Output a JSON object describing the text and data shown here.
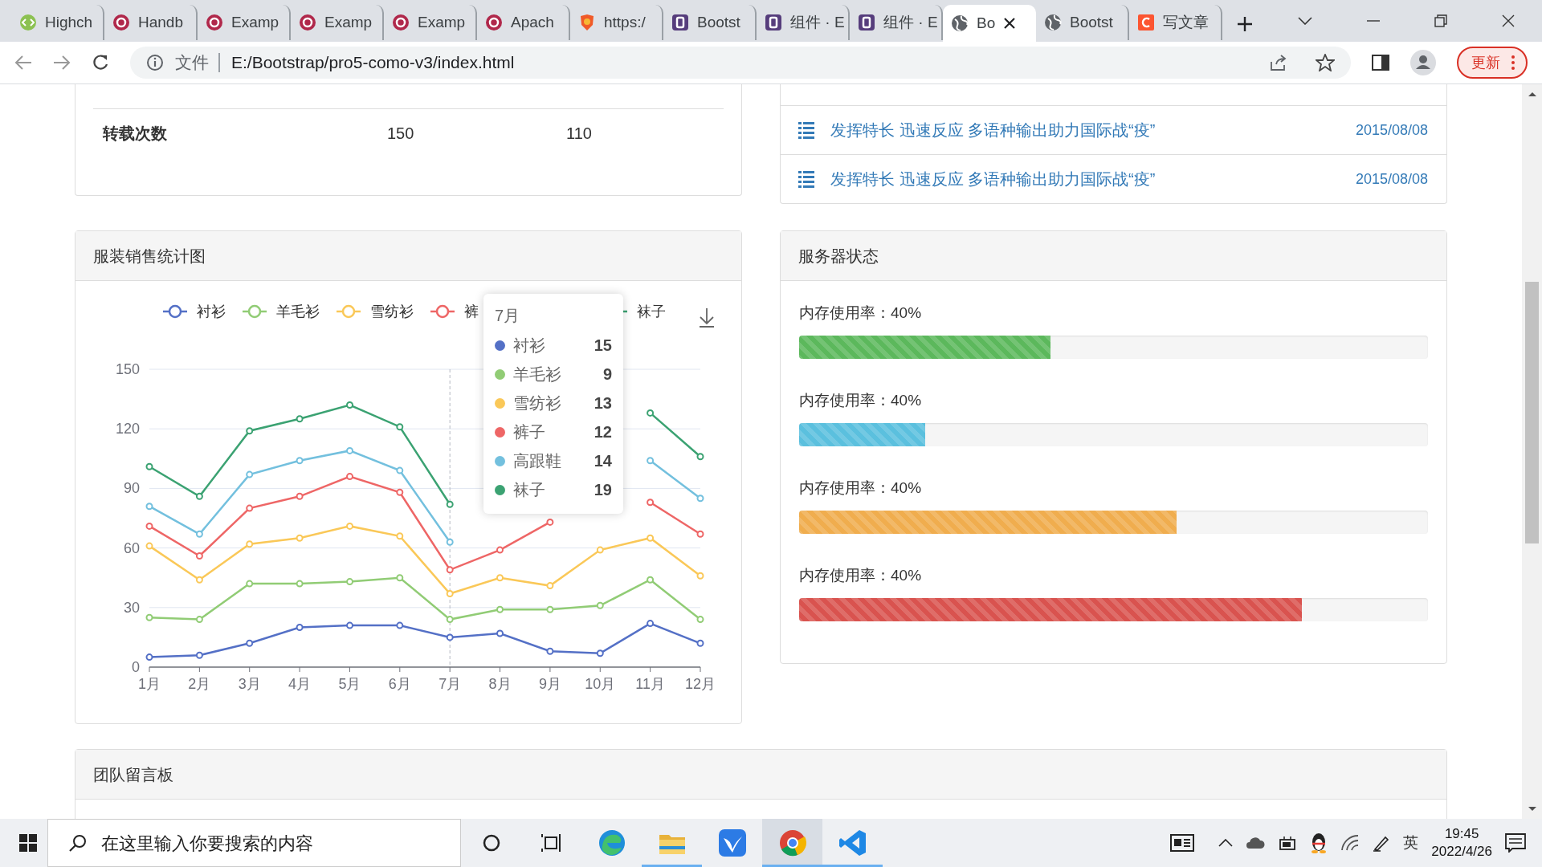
{
  "browser": {
    "tabs": [
      {
        "title": "Highch",
        "kind": "code",
        "selected": false
      },
      {
        "title": "Handb",
        "kind": "ring",
        "selected": false
      },
      {
        "title": "Examp",
        "kind": "ring",
        "selected": false
      },
      {
        "title": "Examp",
        "kind": "ring",
        "selected": false
      },
      {
        "title": "Examp",
        "kind": "ring",
        "selected": false
      },
      {
        "title": "Apach",
        "kind": "ring",
        "selected": false
      },
      {
        "title": "https:/",
        "kind": "shield",
        "selected": false
      },
      {
        "title": "Bootst",
        "kind": "square",
        "selected": false
      },
      {
        "title": "组件 · E",
        "kind": "square",
        "selected": false
      },
      {
        "title": "组件 · E",
        "kind": "square",
        "selected": false
      },
      {
        "title": "Bo",
        "kind": "globe",
        "selected": true
      },
      {
        "title": "Bootst",
        "kind": "globe",
        "selected": false
      },
      {
        "title": "写文章",
        "kind": "mark",
        "selected": false
      }
    ],
    "address": {
      "scheme_label": "文件",
      "url": "E:/Bootstrap/pro5-como-v3/index.html"
    },
    "update_button": "更新"
  },
  "stats_table": {
    "rows": [
      {
        "label": "转载次数",
        "values": [
          "150",
          "110"
        ]
      }
    ]
  },
  "news_list": {
    "items": [
      {
        "title": "发挥特长 迅速反应 多语种输出助力国际战“疫”",
        "date": "2015/08/08"
      },
      {
        "title": "发挥特长 迅速反应 多语种输出助力国际战“疫”",
        "date": "2015/08/08"
      }
    ]
  },
  "sales_chart": {
    "title": "服装销售统计图",
    "chart_data": {
      "type": "line",
      "categories": [
        "1月",
        "2月",
        "3月",
        "4月",
        "5月",
        "6月",
        "7月",
        "8月",
        "9月",
        "10月",
        "11月",
        "12月"
      ],
      "ylim": [
        0,
        150
      ],
      "yticks": [
        0,
        30,
        60,
        90,
        120,
        150
      ],
      "grid": {
        "y": true
      },
      "legend": {
        "items": [
          {
            "label": "衬衫",
            "color": "#5470c6"
          },
          {
            "label": "羊毛衫",
            "color": "#91cc75"
          },
          {
            "label": "雪纺衫",
            "color": "#fac858"
          },
          {
            "label": "裤",
            "color": "#ee6666"
          },
          {
            "label": "袜子",
            "color": "#3ba272"
          }
        ]
      },
      "ref_lines": [
        {
          "axis": "x",
          "value": "7月"
        }
      ],
      "series": [
        {
          "name": "衬衫",
          "color": "#5470c6",
          "marker": "circle",
          "values": [
            5,
            6,
            12,
            20,
            21,
            21,
            15,
            17,
            8,
            7,
            22,
            12
          ]
        },
        {
          "name": "羊毛衫",
          "color": "#91cc75",
          "marker": "circle",
          "values": [
            25,
            24,
            42,
            42,
            43,
            45,
            24,
            29,
            29,
            31,
            44,
            24
          ]
        },
        {
          "name": "雪纺衫",
          "color": "#fac858",
          "marker": "circle",
          "values": [
            61,
            44,
            62,
            65,
            71,
            66,
            37,
            45,
            41,
            59,
            65,
            46
          ]
        },
        {
          "name": "裤子",
          "color": "#ee6666",
          "marker": "circle",
          "values": [
            71,
            56,
            80,
            86,
            96,
            88,
            49,
            59,
            73,
            null,
            83,
            67
          ]
        },
        {
          "name": "高跟鞋",
          "color": "#73c0de",
          "marker": "circle",
          "values": [
            81,
            67,
            97,
            104,
            109,
            99,
            63,
            null,
            null,
            null,
            104,
            85
          ]
        },
        {
          "name": "袜子",
          "color": "#3ba272",
          "marker": "circle",
          "values": [
            101,
            86,
            119,
            125,
            132,
            121,
            82,
            null,
            null,
            null,
            128,
            106
          ]
        }
      ]
    },
    "tooltip": {
      "title": "7月",
      "values": [
        "15",
        "9",
        "13",
        "12",
        "14",
        "19"
      ]
    }
  },
  "server_status": {
    "title": "服务器状态",
    "bars": [
      {
        "label": "内存使用率：40%",
        "level": 0.4,
        "color": "#5cb85c"
      },
      {
        "label": "内存使用率：40%",
        "level": 0.2,
        "color": "#5bc0de"
      },
      {
        "label": "内存使用率：40%",
        "level": 0.6,
        "color": "#f0ad4e"
      },
      {
        "label": "内存使用率：40%",
        "level": 0.8,
        "color": "#d9534f"
      }
    ]
  },
  "message_board": {
    "title": "团队留言板"
  },
  "taskbar": {
    "search_placeholder": "在这里输入你要搜索的内容",
    "apps": [
      {
        "kind": "edge",
        "running": false,
        "selected": false
      },
      {
        "kind": "folder",
        "running": true,
        "selected": false
      },
      {
        "kind": "bird",
        "running": false,
        "selected": false
      },
      {
        "kind": "chrome",
        "running": true,
        "selected": true
      },
      {
        "kind": "code",
        "running": true,
        "selected": false
      }
    ],
    "ime": "英",
    "time": "19:45",
    "date": "2022/4/26"
  }
}
